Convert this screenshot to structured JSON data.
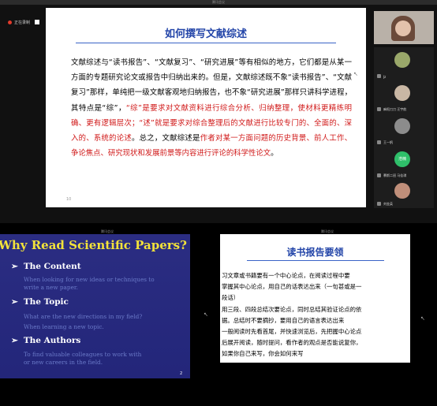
{
  "top_window": {
    "title": "腾讯会议",
    "recording_label": "正在录制",
    "slide": {
      "title": "如何撰写文献综述",
      "body_segments": [
        {
          "text": "文献综述与“读书报告”、“文献复习”、“研究进展”等有相似的地方，它们都是从某一方面的专题研究论文或报告中归纳出来的。但是，文献综述既不象“读书报告”、“文献复习”那样，单纯把一级文献客观地归纳报告，也不象“研究进展”那样只讲科学进程，其特点是“综”，",
          "color": "#000000"
        },
        {
          "text": "“综”是要求对文献资料进行综合分析、归纳整理，使材料更精练明确、更有逻辑层次；“述”就是要求对综合整理后的文献进行比较专门的、全面的、深入的、系统的论述",
          "color": "#d01818"
        },
        {
          "text": "。总之，文献综述是",
          "color": "#000000"
        },
        {
          "text": "作者对某一方面问题的历史背景、前人工作、争论焦点、研究现状和发展前景等内容进行评论的科学性论文",
          "color": "#d01818"
        },
        {
          "text": "。",
          "color": "#000000"
        }
      ],
      "page_number": "10"
    },
    "participants": [
      {
        "name": "",
        "type": "video"
      },
      {
        "name": "Jz",
        "type": "avatar",
        "avatar_color": "#9aa86a"
      },
      {
        "name": "麻阳刀刀 汪宇航",
        "type": "avatar",
        "avatar_color": "#c9b7a4"
      },
      {
        "name": "王一帆",
        "type": "avatar",
        "avatar_color": "#8c8c8c"
      },
      {
        "name": "慕斯二班 马佳琪",
        "type": "avatar",
        "avatar_color": "#2fbf6a",
        "avatar_text": "浩楠"
      },
      {
        "name": "刘金英",
        "type": "avatar",
        "avatar_color": "#c08f7a"
      }
    ]
  },
  "bottom_left_window": {
    "title": "腾讯会议",
    "slide": {
      "title": "Why Read Scientific Papers?",
      "sections": [
        {
          "heading": "The Content",
          "lines": [
            "When looking for new ideas or techniques to",
            "write a new paper."
          ]
        },
        {
          "heading": "The Topic",
          "lines": [
            "What are the new directions in my field?",
            "When learning a new topic."
          ]
        },
        {
          "heading": "The Authors",
          "lines": [
            "To find valuable colleagues to work with",
            "or new careers in the field."
          ]
        }
      ],
      "page_number": "2"
    }
  },
  "bottom_right_window": {
    "title": "腾讯会议",
    "slide": {
      "title": "读书报告要领",
      "lines": [
        "习文章或书籍要有一个中心论点，在阅读过程中要",
        "掌握其中心论点，用自己的话表达出来（一句甚或是一",
        "段话）",
        "用三段、四段总结次要论点，同时总结其验证论点的依",
        "据。总结时不要摘抄，要用自己的语言表达出来",
        "一般阅读时先看首尾，并快速浏览后，先把握中心论点",
        "后展开阅读，随时提问，看作者的观点是否能说复你，",
        "如果你自己来写，你会如何来写"
      ]
    }
  }
}
